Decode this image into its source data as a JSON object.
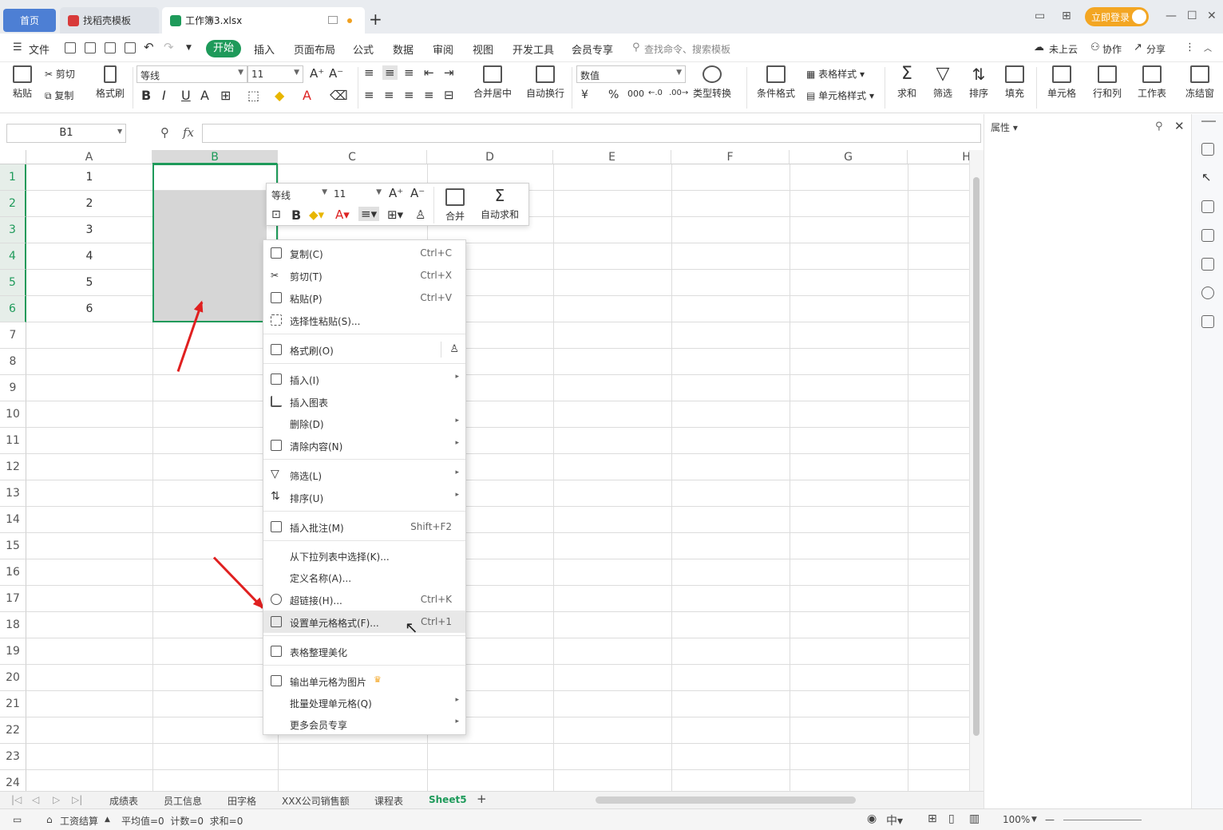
{
  "titlebar": {
    "tabs": [
      {
        "label": "首页"
      },
      {
        "label": "找稻壳模板"
      },
      {
        "label": "工作簿3.xlsx"
      }
    ],
    "login": "立即登录"
  },
  "menubar": {
    "file": "文件",
    "items": [
      "开始",
      "插入",
      "页面布局",
      "公式",
      "数据",
      "审阅",
      "视图",
      "开发工具",
      "会员专享"
    ],
    "search_placeholder": "查找命令、搜索模板",
    "right": [
      "未上云",
      "协作",
      "分享"
    ]
  },
  "ribbon": {
    "paste": "粘贴",
    "cut": "剪切",
    "copy": "复制",
    "format_painter": "格式刷",
    "font": "等线",
    "size": "11",
    "merge": "合并居中",
    "wrap": "自动换行",
    "number_format": "数值",
    "convert": "类型转换",
    "cond_format": "条件格式",
    "table_style": "表格样式",
    "cell_style": "单元格样式",
    "sum": "求和",
    "filter": "筛选",
    "sort": "排序",
    "fill": "填充",
    "cell": "单元格",
    "rowcol": "行和列",
    "sheet": "工作表",
    "freeze": "冻结窗"
  },
  "formula": {
    "namebox": "B1",
    "fx": "fx"
  },
  "grid": {
    "columns": [
      "A",
      "B",
      "C",
      "D",
      "E",
      "F",
      "G",
      "H"
    ],
    "rows": [
      "1",
      "2",
      "3",
      "4",
      "5",
      "6",
      "7",
      "8",
      "9",
      "10",
      "11",
      "12",
      "13",
      "14",
      "15",
      "16",
      "17",
      "18",
      "19",
      "20",
      "21",
      "22",
      "23",
      "24"
    ],
    "col_a_values": [
      "1",
      "2",
      "3",
      "4",
      "5",
      "6"
    ]
  },
  "minitoolbar": {
    "font": "等线",
    "size": "11",
    "merge": "合并",
    "autosum": "自动求和"
  },
  "contextmenu": {
    "items": [
      {
        "label": "复制(C)",
        "shortcut": "Ctrl+C"
      },
      {
        "label": "剪切(T)",
        "shortcut": "Ctrl+X"
      },
      {
        "label": "粘贴(P)",
        "shortcut": "Ctrl+V"
      },
      {
        "label": "选择性粘贴(S)..."
      },
      {
        "label": "格式刷(O)"
      },
      {
        "label": "插入(I)"
      },
      {
        "label": "插入图表"
      },
      {
        "label": "删除(D)"
      },
      {
        "label": "清除内容(N)"
      },
      {
        "label": "筛选(L)"
      },
      {
        "label": "排序(U)"
      },
      {
        "label": "插入批注(M)",
        "shortcut": "Shift+F2"
      },
      {
        "label": "从下拉列表中选择(K)..."
      },
      {
        "label": "定义名称(A)..."
      },
      {
        "label": "超链接(H)...",
        "shortcut": "Ctrl+K"
      },
      {
        "label": "设置单元格格式(F)...",
        "shortcut": "Ctrl+1"
      },
      {
        "label": "表格整理美化"
      },
      {
        "label": "输出单元格为图片"
      },
      {
        "label": "批量处理单元格(Q)"
      },
      {
        "label": "更多会员专享"
      }
    ]
  },
  "sheets": [
    "成绩表",
    "员工信息",
    "田字格",
    "XXX公司销售额",
    "课程表",
    "Sheet5"
  ],
  "status": {
    "wage": "工资结算",
    "stats": "平均值=0  计数=0  求和=0",
    "zoom": "100%"
  },
  "panel": {
    "title": "属性"
  },
  "colors": {
    "accent": "#1e9a5a",
    "home_tab": "#4d7fd4",
    "login": "#f3a623",
    "arrow": "#e02020"
  }
}
